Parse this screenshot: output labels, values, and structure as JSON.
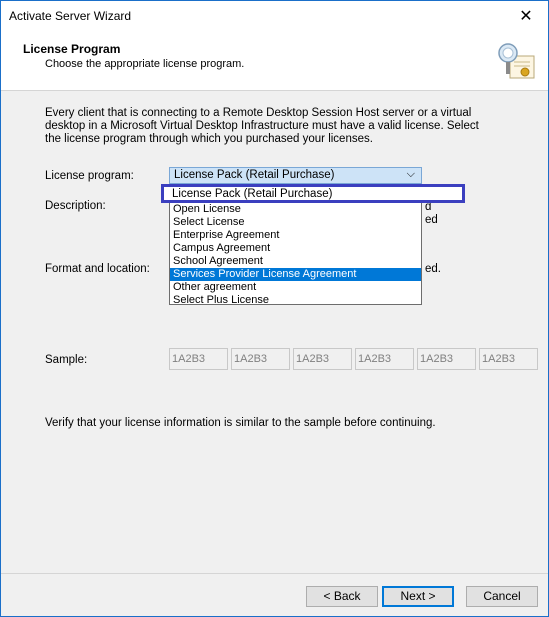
{
  "window": {
    "title": "Activate Server Wizard",
    "close_glyph": "✕"
  },
  "header": {
    "title": "License Program",
    "subtitle": "Choose the appropriate license program.",
    "icon": "certificate-wizard-icon"
  },
  "intro": {
    "line1": "Every client that is connecting to a Remote Desktop Session Host server or a virtual",
    "line2": "desktop in a Microsoft Virtual Desktop Infrastructure must have a valid license. Select",
    "line3": "the license program through which you purchased your licenses."
  },
  "form": {
    "license_label": "License program:",
    "description_label": "Description:",
    "format_label": "Format and location:",
    "sample_label": "Sample:",
    "desc_trail_1": "d",
    "desc_trail_2": "ed",
    "format_trail": "ed."
  },
  "combo": {
    "value": "License Pack (Retail Purchase)",
    "arrow": "⌵"
  },
  "dropdown": {
    "highlighted_item": "License Pack (Retail Purchase)",
    "items": [
      "Open License",
      "Select License",
      "Enterprise Agreement",
      "Campus Agreement",
      "School Agreement",
      "Services Provider License Agreement",
      "Other agreement",
      "Select Plus License"
    ],
    "selected_index": 5
  },
  "sample": [
    "1A2B3",
    "1A2B3",
    "1A2B3",
    "1A2B3",
    "1A2B3",
    "1A2B3"
  ],
  "verify_text": "Verify that your license information is similar to the sample before continuing.",
  "buttons": {
    "back": "< Back",
    "next": "Next >",
    "cancel": "Cancel"
  },
  "colors": {
    "accent": "#0078d7",
    "highlight_box": "#3b3fbf",
    "combo_bg": "#cde3f7"
  }
}
